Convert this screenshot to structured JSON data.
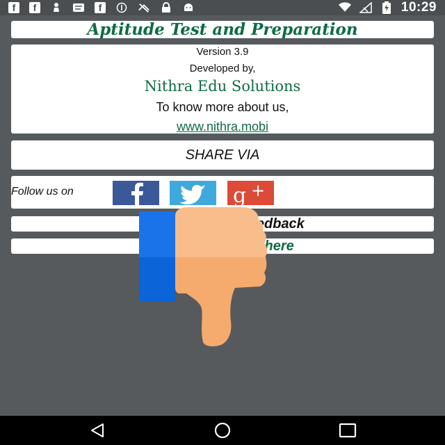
{
  "status_bar": {
    "icons": [
      "facebook-icon",
      "facebook-icon",
      "chess-pawn-icon",
      "message-icon",
      "facebook-icon",
      "info-icon",
      "no-signal-icon",
      "lock-icon",
      "android-icon"
    ],
    "right_icons": [
      "wifi-icon",
      "signal-icon",
      "battery-charging-icon"
    ],
    "time": "10:29"
  },
  "app": {
    "title": "Aptitude Test and Preparation",
    "version": "Version 3.9",
    "developed_by": "Developed by,",
    "company": "Nithra Edu Solutions",
    "know_more": "To know more about us,",
    "website": "www.nithra.mobi"
  },
  "share": {
    "label": "SHARE VIA"
  },
  "follow": {
    "label": "Follow us on",
    "networks": [
      "Facebook",
      "Twitter",
      "Google+"
    ],
    "brand_colors": {
      "facebook": "#3b5998",
      "twitter": "#3fa8dc",
      "google_plus": "#dc4a38"
    }
  },
  "feedback": {
    "label": "Send               e feedback"
  },
  "other_apps": {
    "label": "Our              click here"
  },
  "colors": {
    "accent": "#0e6b45",
    "background": "#565a5c",
    "card": "#ffffff"
  },
  "navbar": {
    "buttons": [
      "back-icon",
      "home-icon",
      "recent-apps-icon"
    ]
  }
}
